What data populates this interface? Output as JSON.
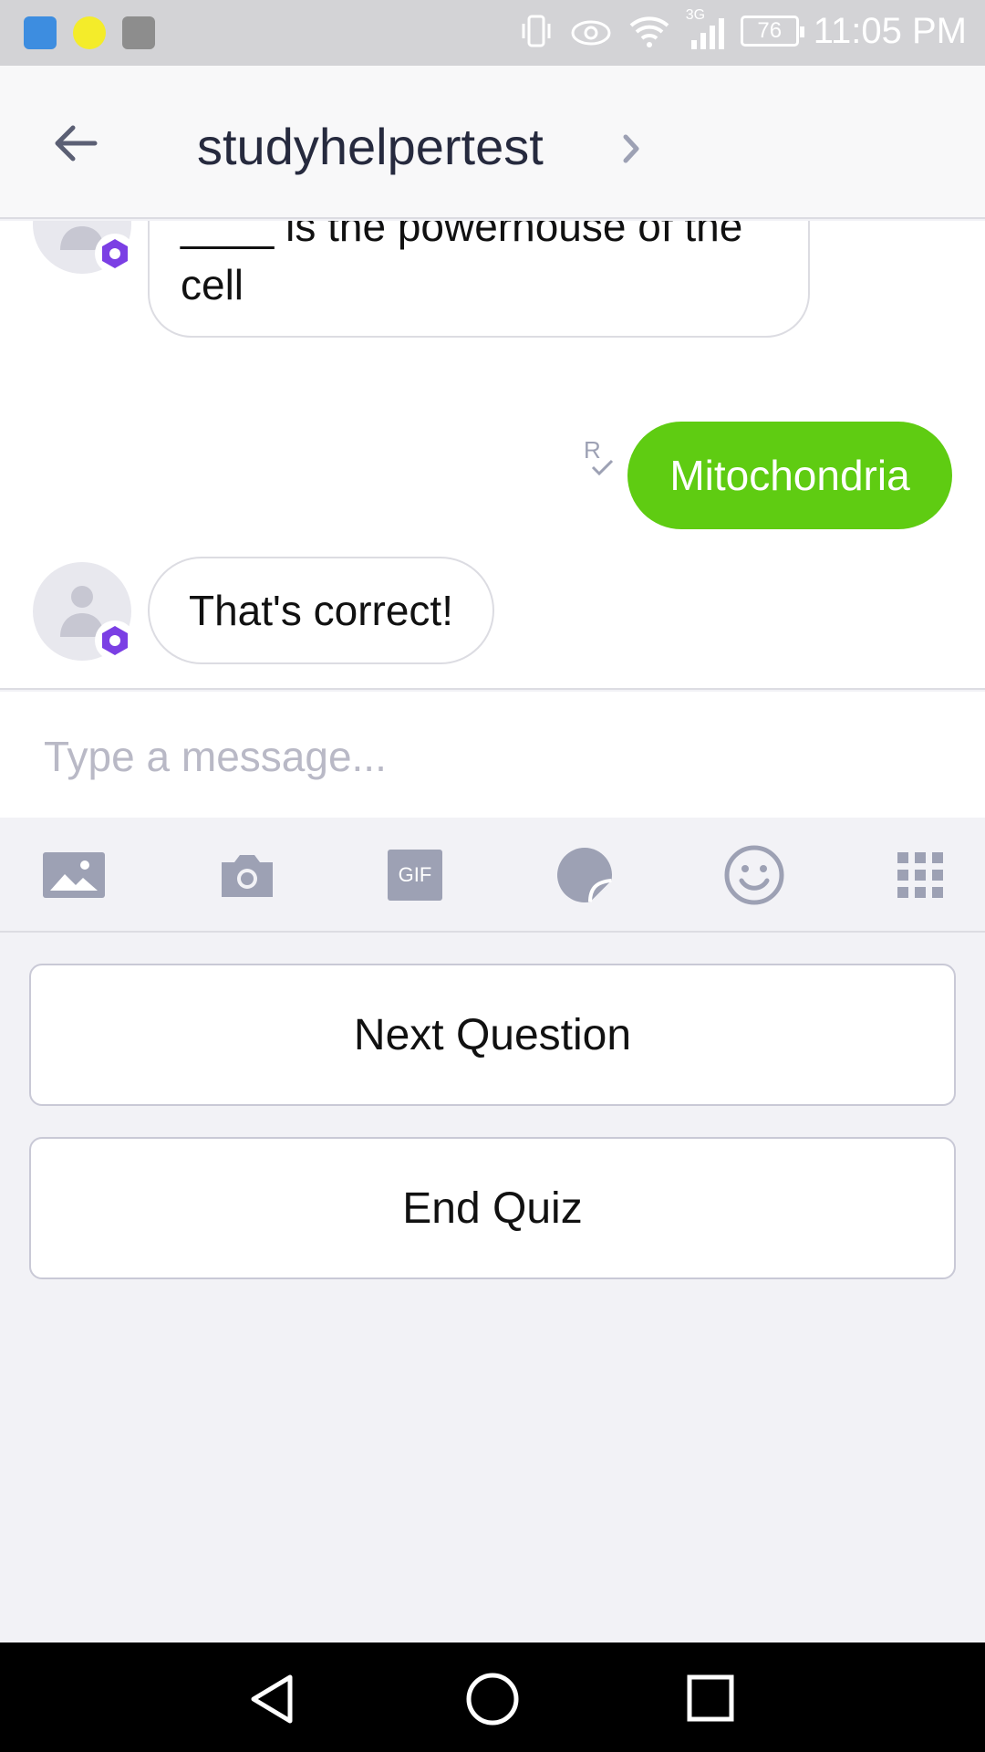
{
  "status_bar": {
    "battery": "76",
    "network": "3G",
    "time": "11:05 PM"
  },
  "header": {
    "title": "studyhelpertest"
  },
  "messages": [
    {
      "sender": "bot",
      "text": "Starting Quiz... First Question: ____ is the powerhouse of the cell"
    },
    {
      "sender": "me",
      "text": "Mitochondria",
      "receipt": "R"
    },
    {
      "sender": "bot",
      "text": "That's correct!"
    }
  ],
  "composer": {
    "placeholder": "Type a message...",
    "tools": [
      "image-icon",
      "camera-icon",
      "gif-icon",
      "sticker-icon",
      "emoji-icon",
      "apps-grid-icon"
    ],
    "gif_label": "GIF"
  },
  "quick_replies": [
    "Next Question",
    "End Quiz"
  ],
  "colors": {
    "outgoing_bubble": "#5fcc12",
    "badge": "#7b3fe4",
    "icon_gray": "#9da1b4"
  }
}
